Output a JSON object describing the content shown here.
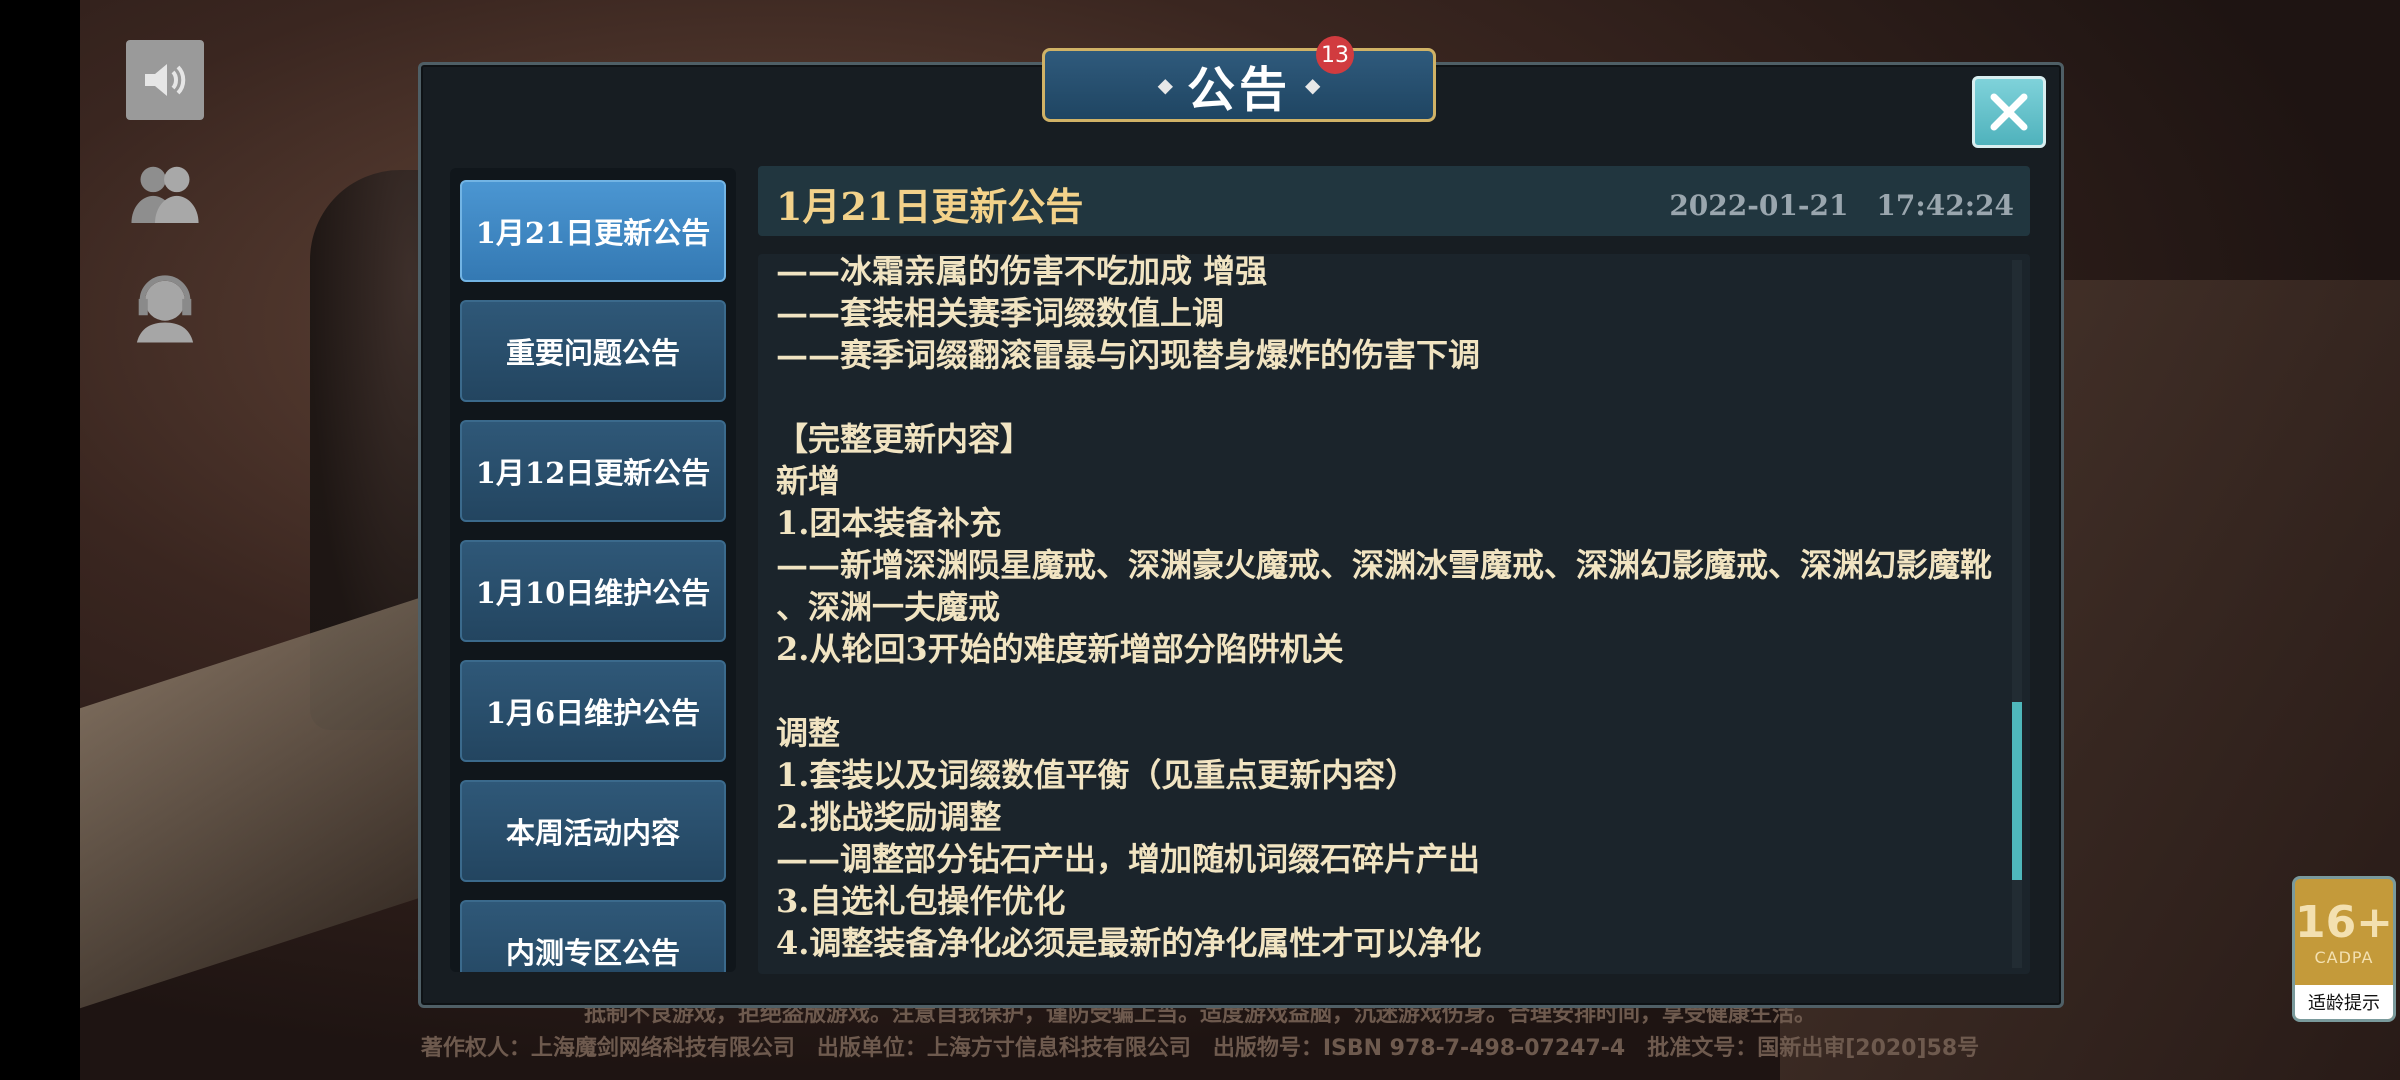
{
  "footer": {
    "line1": "抵制不良游戏，拒绝盗版游戏。注意自我保护，谨防受骗上当。适度游戏益脑，沉迷游戏伤身。合理安排时间，享受健康生活。",
    "line2": "著作权人：上海魔剑网络科技有限公司　出版单位：上海方寸信息科技有限公司　出版物号：ISBN 978-7-498-07247-4　批准文号：国新出审[2020]58号"
  },
  "age_rating": {
    "number": "16+",
    "org": "CADPA",
    "tip": "适龄提示"
  },
  "dialog": {
    "title": "公告",
    "badge_count": "13",
    "tabs": [
      {
        "label": "1月21日更新公告"
      },
      {
        "label": "重要问题公告"
      },
      {
        "label": "1月12日更新公告"
      },
      {
        "label": "1月10日维护公告"
      },
      {
        "label": "1月6日维护公告"
      },
      {
        "label": "本周活动内容"
      },
      {
        "label": "内测专区公告"
      }
    ],
    "header": {
      "title": "1月21日更新公告",
      "datetime": "2022-01-21　17:42:24"
    },
    "content_lines": [
      "——冰霜亲属的伤害不吃加成 增强",
      "——套装相关赛季词缀数值上调",
      "——赛季词缀翻滚雷暴与闪现替身爆炸的伤害下调",
      "",
      "【完整更新内容】",
      "新增",
      "1.团本装备补充",
      "——新增深渊陨星魔戒、深渊豪火魔戒、深渊冰雪魔戒、深渊幻影魔戒、深渊幻影魔靴",
      "、深渊一夫魔戒",
      "2.从轮回3开始的难度新增部分陷阱机关",
      "",
      "调整",
      "1.套装以及词缀数值平衡（见重点更新内容）",
      "2.挑战奖励调整",
      "——调整部分钻石产出，增加随机词缀石碎片产出",
      "3.自选礼包操作优化",
      "4.调整装备净化必须是最新的净化属性才可以净化"
    ]
  },
  "icons": {
    "sound": "speaker-icon",
    "friends": "friends-icon",
    "service": "customer-service-icon",
    "close": "close-icon"
  }
}
